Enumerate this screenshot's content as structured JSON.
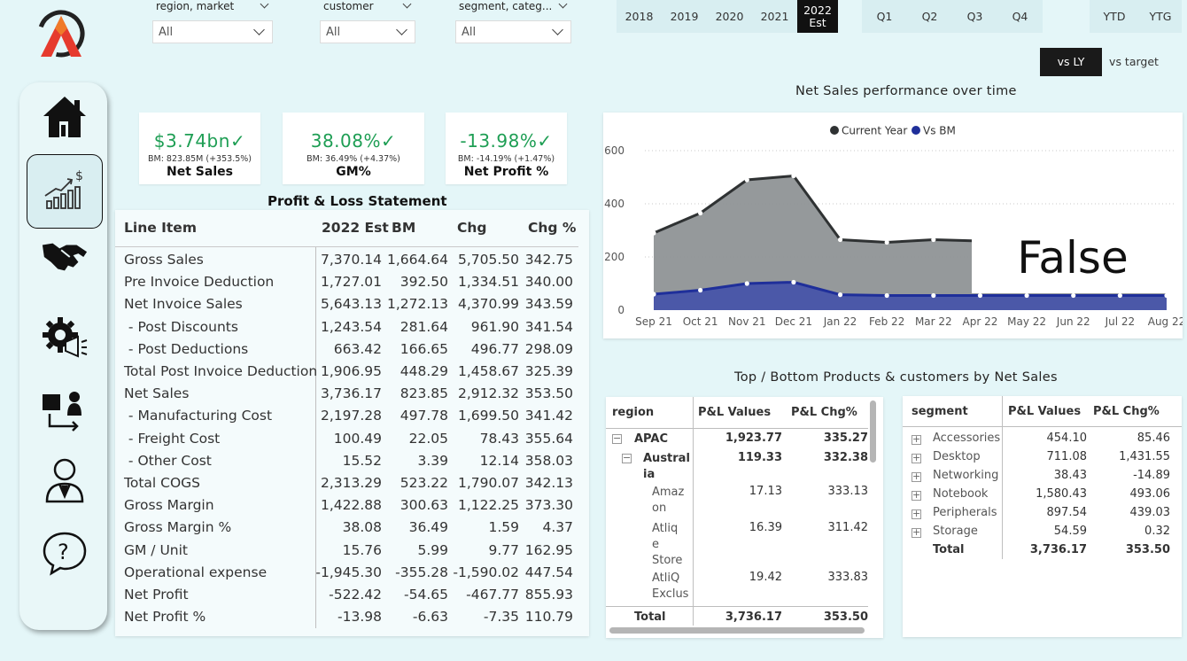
{
  "filters": [
    {
      "label": "region, market",
      "value": "All"
    },
    {
      "label": "customer",
      "value": "All"
    },
    {
      "label": "segment, categ...",
      "value": "All"
    }
  ],
  "years": [
    "2018",
    "2019",
    "2020",
    "2021"
  ],
  "selected_year": {
    "line1": "2022",
    "line2": "Est"
  },
  "quarters": [
    "Q1",
    "Q2",
    "Q3",
    "Q4"
  ],
  "period_toggles": [
    "YTD",
    "YTG"
  ],
  "compare": {
    "active": "vs LY",
    "inactive": "vs target"
  },
  "kpis": [
    {
      "value": "$3.74bn",
      "bm": "BM: 823.85M (+353.5%)",
      "label": "Net Sales"
    },
    {
      "value": "38.08%",
      "bm": "BM: 36.49% (+4.37%)",
      "label": "GM%"
    },
    {
      "value": "-13.98%",
      "bm": "BM: -14.19% (+1.47%)",
      "label": "Net Profit %"
    }
  ],
  "pl": {
    "title": "Profit & Loss Statement",
    "headers": [
      "Line Item",
      "2022 Est",
      "BM",
      "Chg",
      "Chg %"
    ],
    "rows": [
      [
        "Gross Sales",
        "7,370.14",
        "1,664.64",
        "5,705.50",
        "342.75"
      ],
      [
        "Pre Invoice Deduction",
        "1,727.01",
        "392.50",
        "1,334.51",
        "340.00"
      ],
      [
        "Net Invoice Sales",
        "5,643.13",
        "1,272.13",
        "4,370.99",
        "343.59"
      ],
      [
        " - Post Discounts",
        "1,243.54",
        "281.64",
        "961.90",
        "341.54"
      ],
      [
        " - Post Deductions",
        "663.42",
        "166.65",
        "496.77",
        "298.09"
      ],
      [
        "Total Post Invoice Deduction",
        "1,906.95",
        "448.29",
        "1,458.67",
        "325.39"
      ],
      [
        "Net Sales",
        "3,736.17",
        "823.85",
        "2,912.32",
        "353.50"
      ],
      [
        " - Manufacturing Cost",
        "2,197.28",
        "497.78",
        "1,699.50",
        "341.42"
      ],
      [
        " - Freight Cost",
        "100.49",
        "22.05",
        "78.43",
        "355.64"
      ],
      [
        " - Other Cost",
        "15.52",
        "3.39",
        "12.14",
        "358.03"
      ],
      [
        "Total COGS",
        "2,313.29",
        "523.22",
        "1,790.07",
        "342.13"
      ],
      [
        "Gross Margin",
        "1,422.88",
        "300.63",
        "1,122.25",
        "373.30"
      ],
      [
        "Gross Margin %",
        "38.08",
        "36.49",
        "1.59",
        "4.37"
      ],
      [
        "GM / Unit",
        "15.76",
        "5.99",
        "9.77",
        "162.95"
      ],
      [
        "Operational expense",
        "-1,945.30",
        "-355.28",
        "-1,590.02",
        "447.54"
      ],
      [
        "Net Profit",
        "-522.42",
        "-54.65",
        "-467.77",
        "855.93"
      ],
      [
        "Net Profit %",
        "-13.98",
        "-6.63",
        "-7.35",
        "110.79"
      ]
    ]
  },
  "chart_data": {
    "type": "area",
    "title": "Net Sales performance over time",
    "categories": [
      "Sep 21",
      "Oct 21",
      "Nov 21",
      "Dec 21",
      "Jan 22",
      "Feb 22",
      "Mar 22",
      "Apr 22",
      "May 22",
      "Jun 22",
      "Jul 22",
      "Aug 22"
    ],
    "series": [
      {
        "name": "Current Year",
        "color": "#2f3233",
        "fill": "#8f9496",
        "values": [
          290,
          365,
          490,
          505,
          265,
          255,
          265,
          260,
          260,
          260,
          260,
          260
        ]
      },
      {
        "name": "Vs BM",
        "color": "#1f2f9a",
        "fill": "#4b58a8",
        "values": [
          60,
          75,
          100,
          105,
          58,
          55,
          55,
          55,
          55,
          55,
          55,
          55
        ]
      }
    ],
    "yticks": [
      "0",
      "200",
      "400",
      "600"
    ],
    "ylim": [
      0,
      600
    ],
    "legend": "top-center",
    "overlay_text": "False"
  },
  "bottom_title": "Top / Bottom Products & customers by Net Sales",
  "region_table": {
    "headers": [
      "region",
      "P&L Values",
      "P&L Chg%"
    ],
    "rows": [
      {
        "name": "APAC",
        "value": "1,923.77",
        "chg": "335.27"
      },
      {
        "name": "Austral\nia",
        "value": "119.33",
        "chg": "332.38"
      },
      {
        "name": "Amaz\non",
        "value": "17.13",
        "chg": "333.13"
      },
      {
        "name": "Atliq\ne\nStore",
        "value": "16.39",
        "chg": "311.42"
      },
      {
        "name": "AtliQ\nExclus",
        "value": "19.42",
        "chg": "333.83"
      }
    ],
    "total": {
      "name": "Total",
      "value": "3,736.17",
      "chg": "353.50"
    }
  },
  "segment_table": {
    "headers": [
      "segment",
      "P&L Values",
      "P&L Chg%"
    ],
    "rows": [
      {
        "name": "Accessories",
        "value": "454.10",
        "chg": "85.46"
      },
      {
        "name": "Desktop",
        "value": "711.08",
        "chg": "1,431.55"
      },
      {
        "name": "Networking",
        "value": "38.43",
        "chg": "-14.89"
      },
      {
        "name": "Notebook",
        "value": "1,580.43",
        "chg": "493.06"
      },
      {
        "name": "Peripherals",
        "value": "897.54",
        "chg": "439.03"
      },
      {
        "name": "Storage",
        "value": "54.59",
        "chg": "0.32"
      }
    ],
    "total": {
      "name": "Total",
      "value": "3,736.17",
      "chg": "353.50"
    }
  }
}
